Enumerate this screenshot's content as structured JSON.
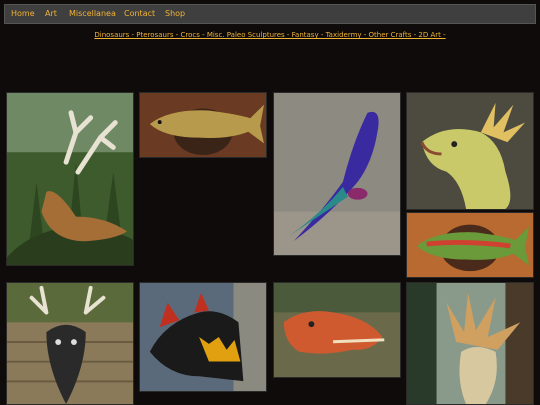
{
  "nav": {
    "items": [
      {
        "label": "Home"
      },
      {
        "label": "Art"
      },
      {
        "label": "Miscellanea"
      },
      {
        "label": "Contact"
      },
      {
        "label": "Shop"
      }
    ]
  },
  "categories_line": "Dinosaurs - Pterosaurs - Crocs - Misc. Paleo Sculptures - Fantasy - Taxidermy - Other Crafts - 2D Art -",
  "gallery": {
    "thumbnails": [
      {
        "subject": "antlered dragon head in garden",
        "bg": "#3d5b2c",
        "accent": "#a46e36"
      },
      {
        "subject": "brown trout mount",
        "bg": "#6a3a22",
        "accent": "#b89a4c"
      },
      {
        "subject": "iridescent parrot sculpture",
        "bg": "#8d8a82",
        "accent": "#3a2aa0"
      },
      {
        "subject": "horned dragon head",
        "bg": "#4d4a40",
        "accent": "#c9c96a"
      },
      {
        "subject": "rainbow trout mount",
        "bg": "#b86a30",
        "accent": "#6a9a3a"
      },
      {
        "subject": "antlered creature head",
        "bg": "#5a6a3a",
        "accent": "#2a2a2a"
      },
      {
        "subject": "black and yellow dragon",
        "bg": "#5a6a7a",
        "accent": "#e0a010"
      },
      {
        "subject": "red dragon head",
        "bg": "#6a6a4a",
        "accent": "#d05a30"
      },
      {
        "subject": "frilled dragon",
        "bg": "#8a9a8a",
        "accent": "#d0a060"
      }
    ]
  },
  "colors": {
    "background": "#0e0b0a",
    "nav_bg": "#3f3f3f",
    "link": "#f0b335"
  }
}
